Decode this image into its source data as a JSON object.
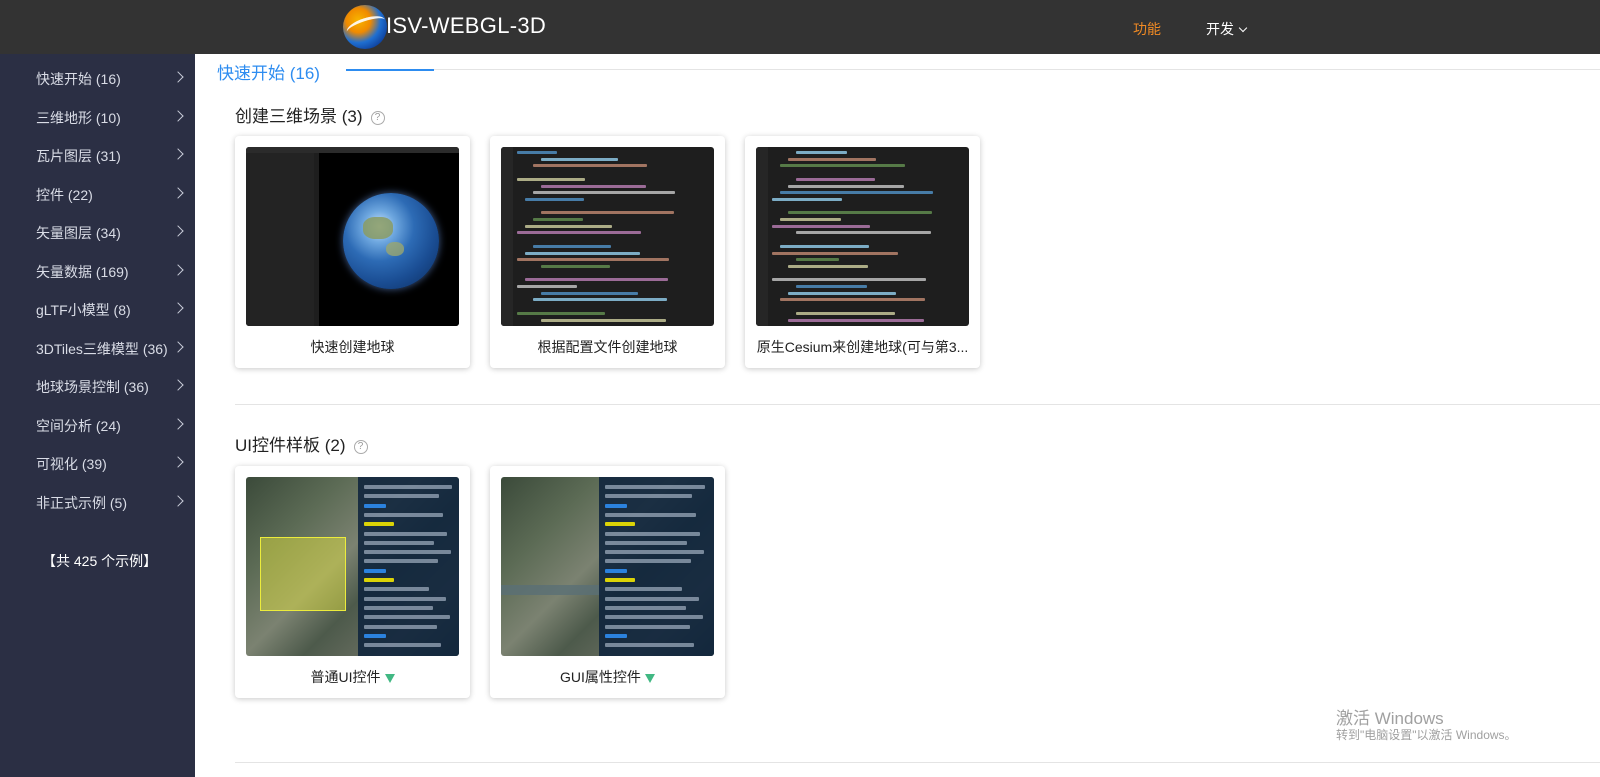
{
  "header": {
    "app_title": "ISV-WEBGL-3D",
    "nav": [
      {
        "label": "功能",
        "active": true
      },
      {
        "label": "开发",
        "has_dropdown": true
      }
    ],
    "accent_color": "#f08a24"
  },
  "sidebar": {
    "items": [
      {
        "label": "快速开始 (16)"
      },
      {
        "label": "三维地形 (10)"
      },
      {
        "label": "瓦片图层 (31)"
      },
      {
        "label": "控件 (22)"
      },
      {
        "label": "矢量图层 (34)"
      },
      {
        "label": "矢量数据 (169)"
      },
      {
        "label": "gLTF小模型 (8)"
      },
      {
        "label": "3DTiles三维模型 (36)"
      },
      {
        "label": "地球场景控制 (36)"
      },
      {
        "label": "空间分析 (24)"
      },
      {
        "label": "可视化 (39)"
      },
      {
        "label": "非正式示例 (5)"
      }
    ],
    "total": "【共 425 个示例】"
  },
  "main": {
    "section_title": "快速开始 (16)",
    "groups": [
      {
        "title": "创建三维场景 (3)",
        "cards": [
          {
            "title": "快速创建地球",
            "thumb": "globe-code"
          },
          {
            "title": "根据配置文件创建地球",
            "thumb": "code"
          },
          {
            "title": "原生Cesium来创建地球(可与第3...",
            "thumb": "code"
          }
        ]
      },
      {
        "title": "UI控件样板 (2)",
        "cards": [
          {
            "title": "普通UI控件",
            "vue": true,
            "thumb": "map-ui"
          },
          {
            "title": "GUI属性控件",
            "vue": true,
            "thumb": "map-ui"
          }
        ]
      }
    ]
  },
  "watermark": {
    "line1": "激活 Windows",
    "line2": "转到\"电脑设置\"以激活 Windows。"
  },
  "colors": {
    "topbar": "#333333",
    "sidebar": "#2b2f44",
    "section_blue": "#2d8cf0",
    "vue_green": "#41b883"
  }
}
